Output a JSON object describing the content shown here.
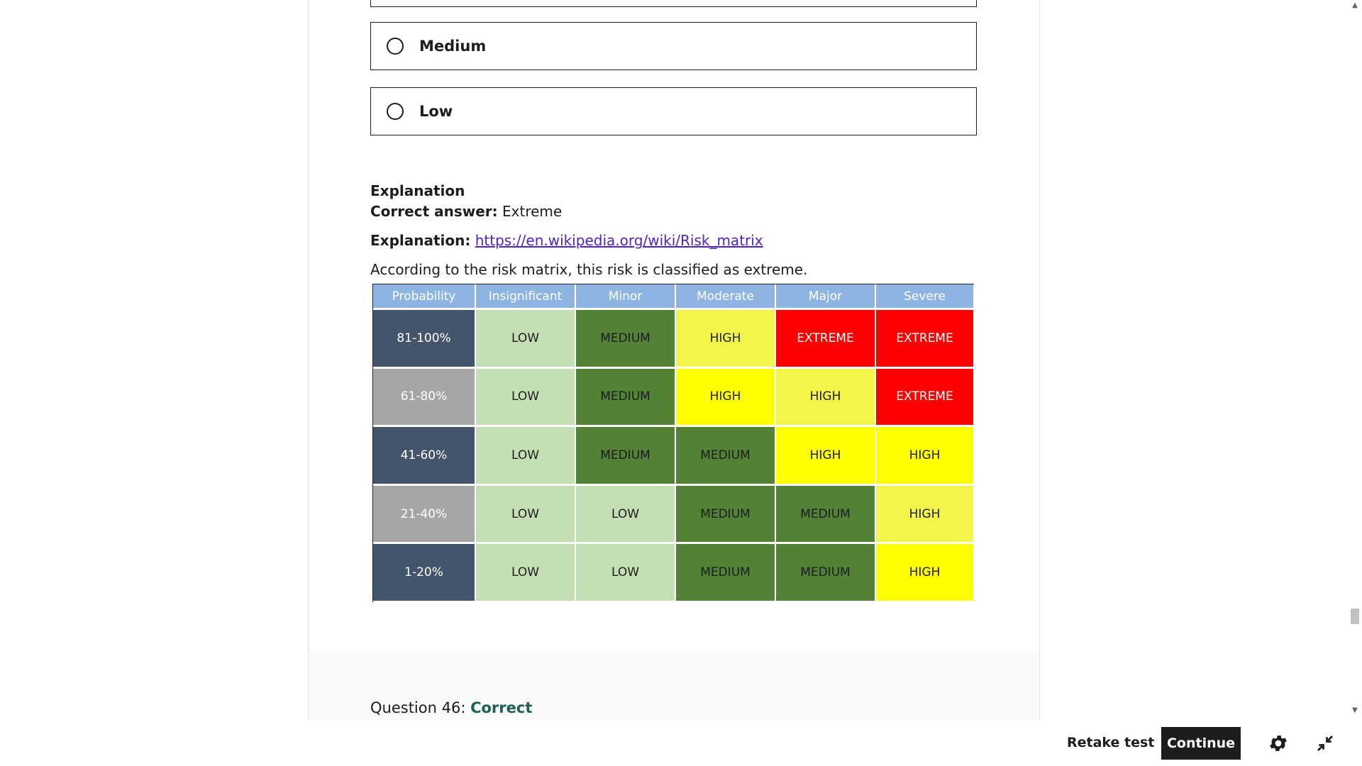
{
  "options": [
    {
      "label": "Medium"
    },
    {
      "label": "Low"
    }
  ],
  "explanation": {
    "title": "Explanation",
    "correct_answer_label": "Correct answer:",
    "correct_answer_value": "Extreme",
    "explanation_label": "Explanation:",
    "explanation_link": "https://en.wikipedia.org/wiki/Risk_matrix",
    "summary": "According to the risk matrix, this risk is classified as extreme."
  },
  "risk_matrix": {
    "headers": [
      "Probability",
      "Insignificant",
      "Minor",
      "Moderate",
      "Major",
      "Severe"
    ],
    "rows": [
      {
        "probability": "81-100%",
        "cells": [
          "LOW",
          "MEDIUM",
          "HIGH",
          "EXTREME",
          "EXTREME"
        ]
      },
      {
        "probability": "61-80%",
        "cells": [
          "LOW",
          "MEDIUM",
          "HIGH",
          "HIGH",
          "EXTREME"
        ]
      },
      {
        "probability": "41-60%",
        "cells": [
          "LOW",
          "MEDIUM",
          "MEDIUM",
          "HIGH",
          "HIGH"
        ]
      },
      {
        "probability": "21-40%",
        "cells": [
          "LOW",
          "LOW",
          "MEDIUM",
          "MEDIUM",
          "HIGH"
        ]
      },
      {
        "probability": "1-20%",
        "cells": [
          "LOW",
          "LOW",
          "MEDIUM",
          "MEDIUM",
          "HIGH"
        ]
      }
    ],
    "colors": {
      "header": "#8db4e2",
      "row_dark": "#44546a",
      "row_gray": "#a6a6a6",
      "LOW": "#c4dfb3",
      "MEDIUM": "#538135",
      "HIGH_light": "#f3f54a",
      "HIGH_bright": "#ffff00",
      "EXTREME": "#ff0000"
    },
    "high_shade": [
      [
        "light",
        "bright",
        "light",
        "bright",
        "light"
      ],
      [
        "light",
        "bright",
        "light",
        "bright",
        "light"
      ]
    ]
  },
  "question_status": {
    "prefix": "Question 46:",
    "result": "Correct"
  },
  "footer": {
    "retake_label": "Retake test",
    "continue_label": "Continue",
    "settings_icon": "gear-icon",
    "collapse_icon": "collapse-icon"
  }
}
